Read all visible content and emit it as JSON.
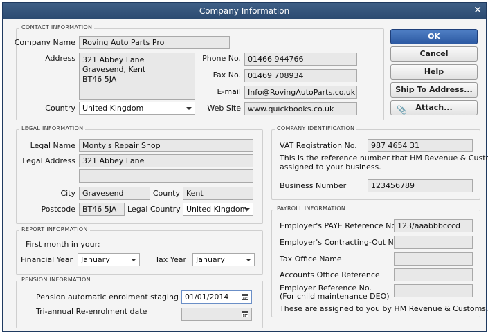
{
  "window": {
    "title": "Company Information"
  },
  "buttons": {
    "ok": "OK",
    "cancel": "Cancel",
    "help": "Help",
    "ship": "Ship To Address...",
    "attach": "Attach..."
  },
  "contact": {
    "legend": "CONTACT INFORMATION",
    "company_name_label": "Company Name",
    "company_name": "Roving Auto Parts Pro",
    "address_label": "Address",
    "address_line1": "321 Abbey Lane",
    "address_line2": "Gravesend, Kent",
    "address_line3": "BT46 5JA",
    "country_label": "Country",
    "country": "United Kingdom",
    "phone_label": "Phone No.",
    "phone": "01466 944766",
    "fax_label": "Fax No.",
    "fax": "01469 708934",
    "email_label": "E-mail",
    "email": "Info@RovingAutoParts.co.uk",
    "website_label": "Web Site",
    "website": "www.quickbooks.co.uk"
  },
  "legal": {
    "legend": "LEGAL INFORMATION",
    "name_label": "Legal Name",
    "name": "Monty's Repair Shop",
    "address_label": "Legal Address",
    "address1": "321 Abbey Lane",
    "address2": "",
    "city_label": "City",
    "city": "Gravesend",
    "county_label": "County",
    "county": "Kent",
    "postcode_label": "Postcode",
    "postcode": "BT46 5JA",
    "country_label": "Legal Country",
    "country": "United Kingdom"
  },
  "company_id": {
    "legend": "COMPANY IDENTIFICATION",
    "vat_label": "VAT Registration No.",
    "vat": "987 4654 31",
    "note1": "This is the reference number that HM Revenue & Customs",
    "note2": "assigned to your business.",
    "business_label": "Business Number",
    "business": "123456789"
  },
  "report": {
    "legend": "REPORT INFORMATION",
    "first_month": "First month in your:",
    "financial_label": "Financial Year",
    "financial": "January",
    "tax_label": "Tax Year",
    "tax": "January"
  },
  "pension": {
    "legend": "PENSION INFORMATION",
    "staging_label": "Pension automatic enrolment staging date",
    "staging": "01/01/2014",
    "reenrol_label": "Tri-annual Re-enrolment date",
    "reenrol": ""
  },
  "payroll": {
    "legend": "PAYROLL INFORMATION",
    "paye_label": "Employer's PAYE Reference No.",
    "paye": "123/aaabbbcccd",
    "contracting_label": "Employer's Contracting-Out No.",
    "contracting": "",
    "tax_office_label": "Tax Office Name",
    "tax_office": "",
    "accounts_office_label": "Accounts Office Reference",
    "accounts_office": "",
    "employer_ref_label1": "Employer Reference No.",
    "employer_ref_label2": "(For child maintenance DEO)",
    "employer_ref": "",
    "footer": "These are assigned to you by HM Revenue & Customs."
  }
}
